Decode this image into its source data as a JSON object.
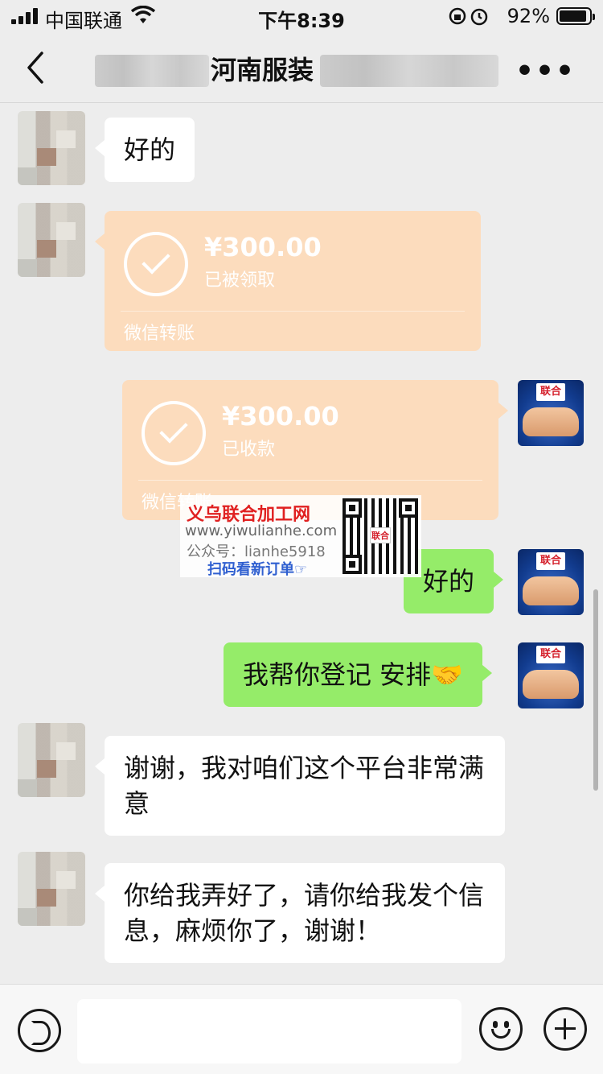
{
  "status_bar": {
    "carrier": "中国联通",
    "time": "下午8:39",
    "battery": "92%",
    "battery_level": 0.92
  },
  "nav": {
    "title": "河南服装",
    "more": "•••"
  },
  "messages": [
    {
      "side": "left",
      "type": "text",
      "text": "好的"
    },
    {
      "side": "left",
      "type": "transfer",
      "amount": "¥300.00",
      "status": "已被领取",
      "footer": "微信转账"
    },
    {
      "side": "right",
      "type": "transfer",
      "amount": "¥300.00",
      "status": "已收款",
      "footer": "微信转账"
    },
    {
      "side": "right",
      "type": "text",
      "text": "好的"
    },
    {
      "side": "right",
      "type": "text",
      "text": "我帮你登记 安排🤝"
    },
    {
      "side": "left",
      "type": "text",
      "text": "谢谢，我对咱们这个平台非常满意"
    },
    {
      "side": "left",
      "type": "text",
      "text": "你给我弄好了，请你给我发个信息，麻烦你了，谢谢！"
    }
  ],
  "watermark": {
    "name": "义乌联合加工网",
    "url": "www.yiwulianhe.com",
    "account": "公众号：lianhe5918",
    "cta": "扫码看新订单☞",
    "qr_logo": "联合"
  },
  "avatar_logo": "联合"
}
